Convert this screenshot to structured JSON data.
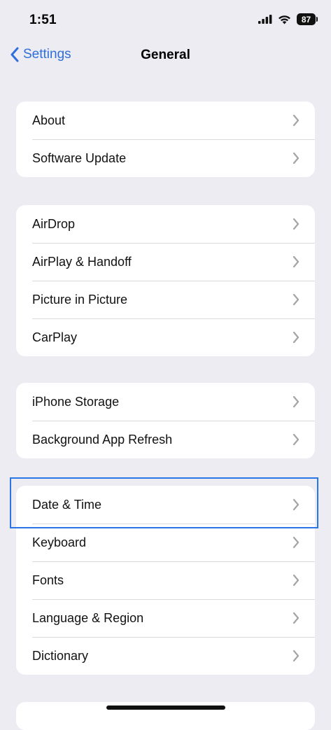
{
  "status_bar": {
    "time": "1:51",
    "battery": "87"
  },
  "nav": {
    "back_label": "Settings",
    "title": "General"
  },
  "groups": [
    {
      "items": [
        {
          "label": "About"
        },
        {
          "label": "Software Update"
        }
      ]
    },
    {
      "items": [
        {
          "label": "AirDrop"
        },
        {
          "label": "AirPlay & Handoff"
        },
        {
          "label": "Picture in Picture"
        },
        {
          "label": "CarPlay"
        }
      ]
    },
    {
      "items": [
        {
          "label": "iPhone Storage"
        },
        {
          "label": "Background App Refresh"
        }
      ]
    },
    {
      "items": [
        {
          "label": "Date & Time"
        },
        {
          "label": "Keyboard"
        },
        {
          "label": "Fonts"
        },
        {
          "label": "Language & Region"
        },
        {
          "label": "Dictionary"
        }
      ]
    }
  ],
  "colors": {
    "accent": "#2f6fdb",
    "background": "#ececf2",
    "highlight": "#2b76e6"
  }
}
